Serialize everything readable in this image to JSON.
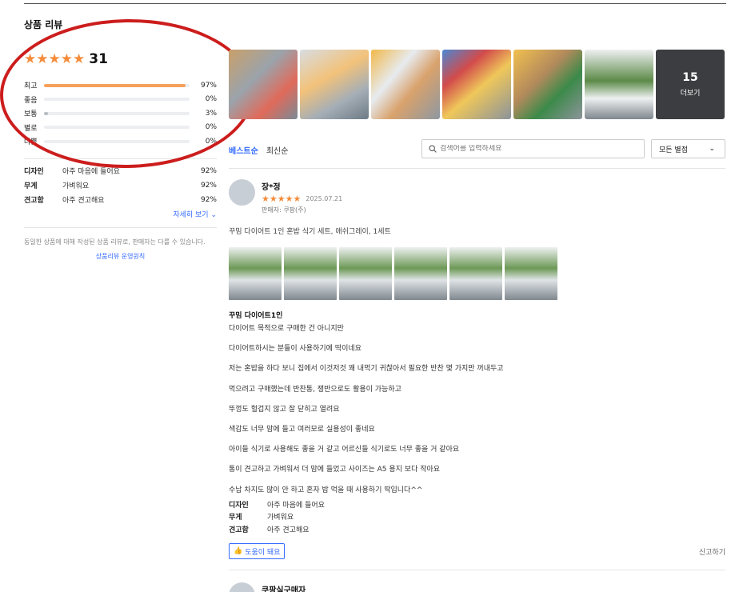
{
  "section_title": "상품 리뷰",
  "summary": {
    "stars": 5,
    "count": "31",
    "distribution": [
      {
        "label": "최고",
        "pct": "97%",
        "value": 97
      },
      {
        "label": "좋음",
        "pct": "0%",
        "value": 0
      },
      {
        "label": "보통",
        "pct": "3%",
        "value": 3
      },
      {
        "label": "별로",
        "pct": "0%",
        "value": 0
      },
      {
        "label": "나쁨",
        "pct": "0%",
        "value": 0
      }
    ],
    "attributes": [
      {
        "name": "디자인",
        "value": "아주 마음에 들어요",
        "pct": "92%"
      },
      {
        "name": "무게",
        "value": "가벼워요",
        "pct": "92%"
      },
      {
        "name": "견고함",
        "value": "아주 견고해요",
        "pct": "92%"
      }
    ],
    "more_label": "자세히 보기",
    "notice": "동일한 상품에 대해 작성된 상품 리뷰로, 판매자는 다를 수 있습니다.",
    "policy_link": "상품리뷰 운영원칙"
  },
  "photo_strip": {
    "more_count": "15",
    "more_label": "더보기"
  },
  "sort": {
    "best": "베스트순",
    "latest": "최신순"
  },
  "search": {
    "placeholder": "검색어를 입력하세요"
  },
  "filter": {
    "selected": "모든 별점"
  },
  "review": {
    "name": "장*정",
    "stars": 5,
    "date": "2025.07.21",
    "seller": "판매자: 쿠팡(주)",
    "product": "꾸밈 다이어트 1인 혼밥 식기 세트, 애쉬그레이, 1세트",
    "headline": "꾸밈 다이어트1인",
    "lines": [
      "다이어트 목적으로 구매한 건 아니지만",
      "다이어트하시는 분들이 사용하기에 딱이네요",
      "저는 혼밥을 하다 보니 집에서 이것저것 꽤 내먹기 귀찮아서 필요한 반찬 몇 가지만 꺼내두고",
      "먹으려고 구매했는데 반찬통, 쟁반으로도 활용이 가능하고",
      "뚜껑도 헐겁지 않고 잘 닫히고 열려요",
      "색감도 너무 맘에 들고 여러모로 실용성이 좋네요",
      "아이들 식기로 사용해도 좋을 거 같고 어르신들 식기로도 너무 좋을 거 같아요",
      "통이 견고하고 가벼워서 더 맘에 들었고 사이즈는 A5 용지 보다 작아요",
      "수납 차지도 많이 안 하고 혼자 밥 먹을 때 사용하기 딱입니다^^"
    ],
    "attributes": [
      {
        "name": "디자인",
        "value": "아주 마음에 들어요"
      },
      {
        "name": "무게",
        "value": "가벼워요"
      },
      {
        "name": "견고함",
        "value": "아주 견고해요"
      }
    ],
    "helpful_label": "도움이 돼요",
    "report_label": "신고하기"
  },
  "next_review": {
    "name": "쿠팡실구매자"
  },
  "colors": {
    "star": "#f48c3b",
    "bar": "#f5a15b",
    "accent": "#346aff",
    "annotation_circle": "#cc1d1d"
  }
}
